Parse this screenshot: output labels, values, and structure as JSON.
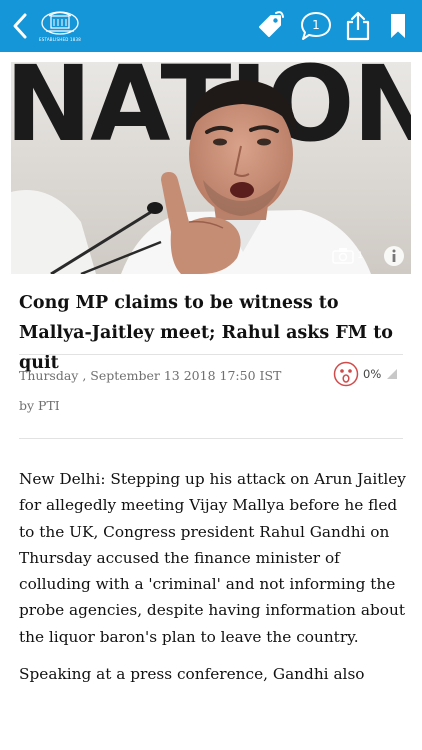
{
  "toolbar": {
    "logo_caption": "ESTABLISHED 1838",
    "comment_count": "1"
  },
  "hero": {
    "photo_count": "1",
    "backdrop_text": "NATION"
  },
  "article": {
    "headline": "Cong MP claims to be witness to Mallya-Jaitley meet; Rahul asks FM to quit",
    "dateline": "Thursday , September 13 2018 17:50 IST",
    "byline": "by PTI",
    "reaction_pct": "0%",
    "paragraphs": [
      "New Delhi: Stepping up his attack on Arun Jaitley for allegedly meeting Vijay Mallya before he fled to the UK, Congress president Rahul Gandhi on Thursday accused the finance minister of colluding with a 'criminal' and not informing the probe agencies, despite having information about the liquor baron's plan to leave the country.",
      "Speaking at a press conference, Gandhi also"
    ]
  },
  "colors": {
    "toolbar_bg": "#1496d8",
    "reaction_accent": "#d14b4b",
    "text": "#111111",
    "meta": "#6f6f6f"
  },
  "icons": [
    "back-arrow-icon",
    "newspaper-logo",
    "tag-icon",
    "comment-bubble-icon",
    "share-icon",
    "bookmark-icon",
    "camera-icon",
    "info-icon",
    "surprised-face-icon",
    "triangle-arrow-icon"
  ]
}
